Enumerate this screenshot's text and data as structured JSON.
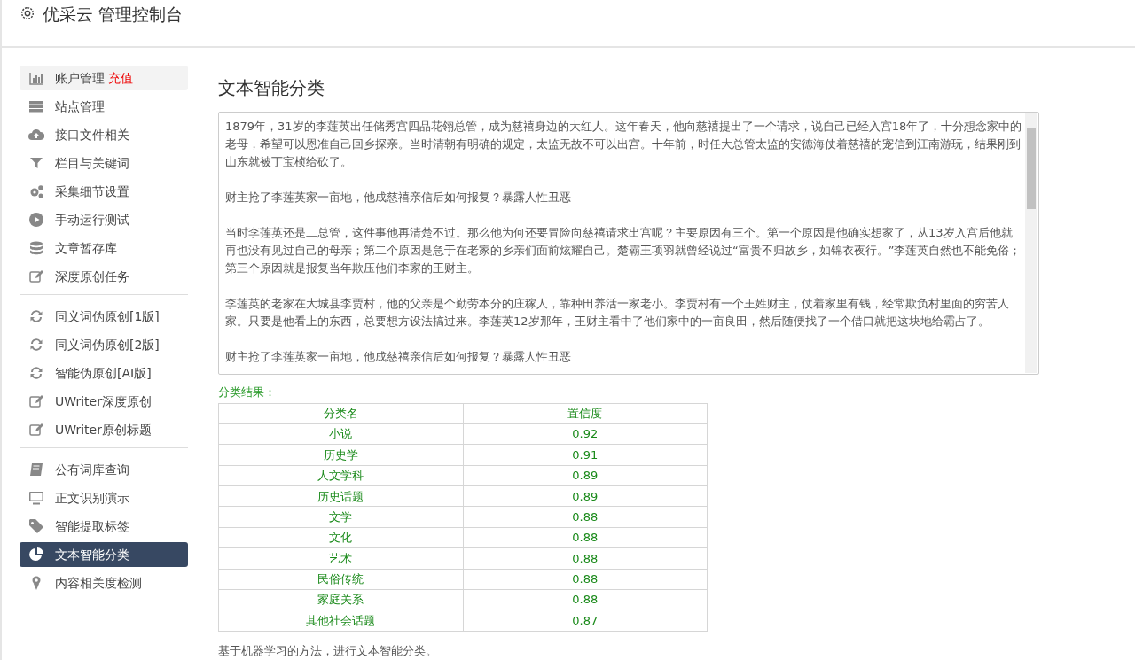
{
  "header": {
    "title": "优采云 管理控制台"
  },
  "sidebar": {
    "groups": [
      {
        "items": [
          {
            "kind": "bars",
            "label": "账户管理",
            "badge": "充值",
            "selected": false,
            "hovered": true
          },
          {
            "kind": "server",
            "label": "站点管理",
            "selected": false,
            "hovered": false
          },
          {
            "kind": "cloud",
            "label": "接口文件相关",
            "selected": false,
            "hovered": false
          },
          {
            "kind": "filter",
            "label": "栏目与关键词",
            "selected": false,
            "hovered": false
          },
          {
            "kind": "gears",
            "label": "采集细节设置",
            "selected": false,
            "hovered": false
          },
          {
            "kind": "play",
            "label": "手动运行测试",
            "selected": false,
            "hovered": false
          },
          {
            "kind": "database",
            "label": "文章暂存库",
            "selected": false,
            "hovered": false
          },
          {
            "kind": "edit",
            "label": "深度原创任务",
            "selected": false,
            "hovered": false
          }
        ]
      },
      {
        "items": [
          {
            "kind": "refresh",
            "label": "同义词伪原创[1版]",
            "selected": false,
            "hovered": false
          },
          {
            "kind": "refresh",
            "label": "同义词伪原创[2版]",
            "selected": false,
            "hovered": false
          },
          {
            "kind": "refresh",
            "label": "智能伪原创[AI版]",
            "selected": false,
            "hovered": false
          },
          {
            "kind": "edit",
            "label": "UWriter深度原创",
            "selected": false,
            "hovered": false
          },
          {
            "kind": "edit",
            "label": "UWriter原创标题",
            "selected": false,
            "hovered": false
          }
        ]
      },
      {
        "items": [
          {
            "kind": "book",
            "label": "公有词库查询",
            "selected": false,
            "hovered": false
          },
          {
            "kind": "monitor",
            "label": "正文识别演示",
            "selected": false,
            "hovered": false
          },
          {
            "kind": "tag",
            "label": "智能提取标签",
            "selected": false,
            "hovered": false
          },
          {
            "kind": "pie",
            "label": "文本智能分类",
            "selected": true,
            "hovered": false
          },
          {
            "kind": "pin",
            "label": "内容相关度检测",
            "selected": false,
            "hovered": false
          }
        ]
      }
    ]
  },
  "main": {
    "title": "文本智能分类",
    "text_input": {
      "paragraphs": [
        "1879年，31岁的李莲英出任储秀宫四品花翎总管，成为慈禧身边的大红人。这年春天，他向慈禧提出了一个请求，说自己已经入宫18年了，十分想念家中的老母，希望可以恩准自己回乡探亲。当时清朝有明确的规定，太监无故不可以出宫。十年前，时任大总管太监的安德海仗着慈禧的宠信到江南游玩，结果刚到山东就被丁宝桢给砍了。",
        "财主抢了李莲英家一亩地，他成慈禧亲信后如何报复？暴露人性丑恶",
        "当时李莲英还是二总管，这件事他再清楚不过。那么他为何还要冒险向慈禧请求出宫呢？主要原因有三个。第一个原因是他确实想家了，从13岁入宫后他就再也没有见过自己的母亲；第二个原因是急于在老家的乡亲们面前炫耀自己。楚霸王项羽就曾经说过“富贵不归故乡，如锦衣夜行。”李莲英自然也不能免俗；第三个原因就是报复当年欺压他们李家的王财主。",
        "李莲英的老家在大城县李贾村，他的父亲是个勤劳本分的庄稼人，靠种田养活一家老小。李贾村有一个王姓财主，仗着家里有钱，经常欺负村里面的穷苦人家。只要是他看上的东西，总要想方设法搞过来。李莲英12岁那年，王财主看中了他们家中的一亩良田，然后随便找了一个借口就把这块地给霸占了。",
        "财主抢了李莲英家一亩地，他成慈禧亲信后如何报复？暴露人性丑恶"
      ]
    },
    "result_label": "分类结果：",
    "table": {
      "columns": [
        "分类名",
        "置信度"
      ],
      "rows": [
        [
          "小说",
          "0.92"
        ],
        [
          "历史学",
          "0.91"
        ],
        [
          "人文学科",
          "0.89"
        ],
        [
          "历史话题",
          "0.89"
        ],
        [
          "文学",
          "0.88"
        ],
        [
          "文化",
          "0.88"
        ],
        [
          "艺术",
          "0.88"
        ],
        [
          "民俗传统",
          "0.88"
        ],
        [
          "家庭关系",
          "0.88"
        ],
        [
          "其他社会话题",
          "0.87"
        ]
      ]
    },
    "footnote": "基于机器学习的方法，进行文本智能分类。"
  }
}
